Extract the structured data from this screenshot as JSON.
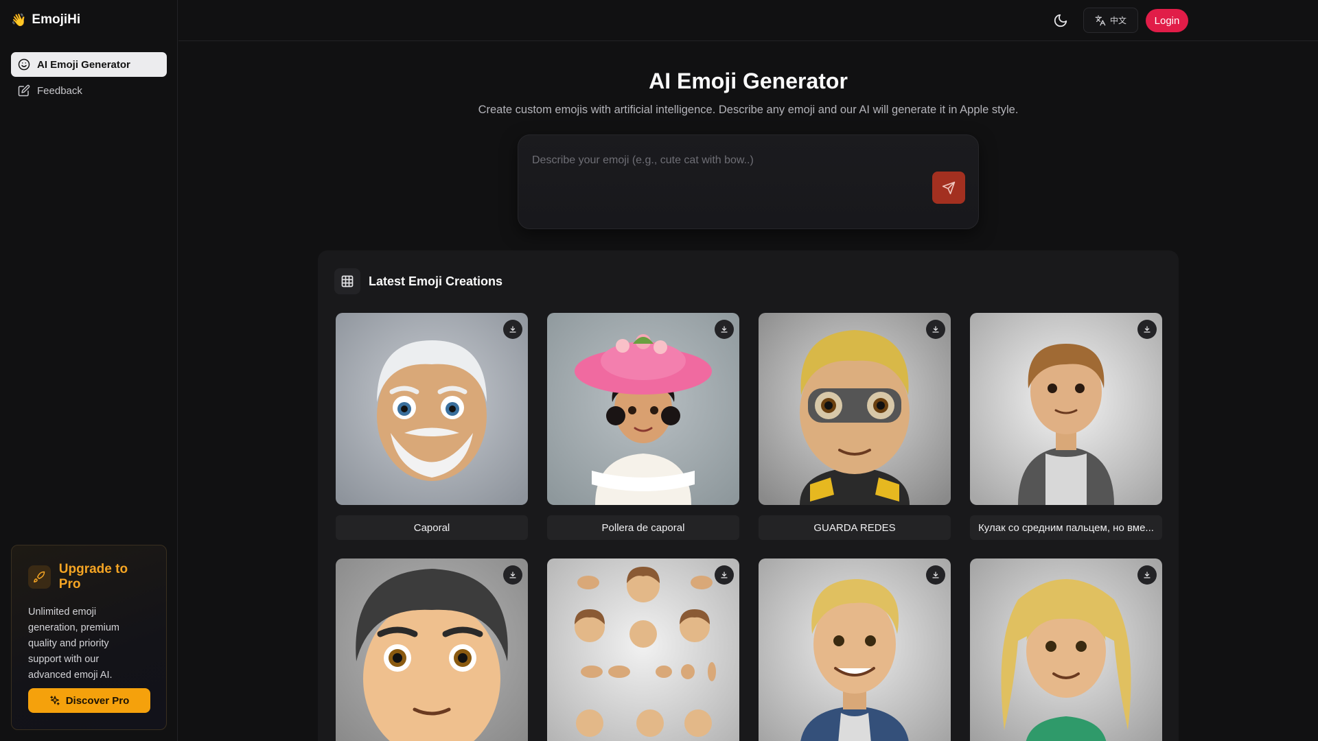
{
  "brand": {
    "name": "EmojiHi",
    "icon": "👋"
  },
  "sidebar": {
    "items": [
      {
        "label": "AI Emoji Generator",
        "icon": "smile-icon",
        "active": true
      },
      {
        "label": "Feedback",
        "icon": "edit-icon",
        "active": false
      }
    ],
    "pro": {
      "title": "Upgrade to Pro",
      "description": "Unlimited emoji generation, premium quality and priority support with our advanced emoji AI.",
      "button": "Discover Pro"
    }
  },
  "topbar": {
    "theme_icon": "moon-icon",
    "language_label": "中文",
    "login_label": "Login"
  },
  "hero": {
    "title": "AI Emoji Generator",
    "subtitle": "Create custom emojis with artificial intelligence. Describe any emoji and our AI will generate it in Apple style.",
    "placeholder": "Describe your emoji (e.g., cute cat with bow..)"
  },
  "gallery": {
    "title": "Latest Emoji Creations",
    "items": [
      {
        "caption": "Caporal"
      },
      {
        "caption": "Pollera de caporal"
      },
      {
        "caption": "GUARDA REDES"
      },
      {
        "caption": "Кулак со средним пальцем, но вме..."
      },
      {
        "caption": ""
      },
      {
        "caption": ""
      },
      {
        "caption": ""
      },
      {
        "caption": ""
      }
    ]
  },
  "colors": {
    "accent": "#e11d48",
    "pro": "#f5a10c",
    "send": "#a33020"
  }
}
